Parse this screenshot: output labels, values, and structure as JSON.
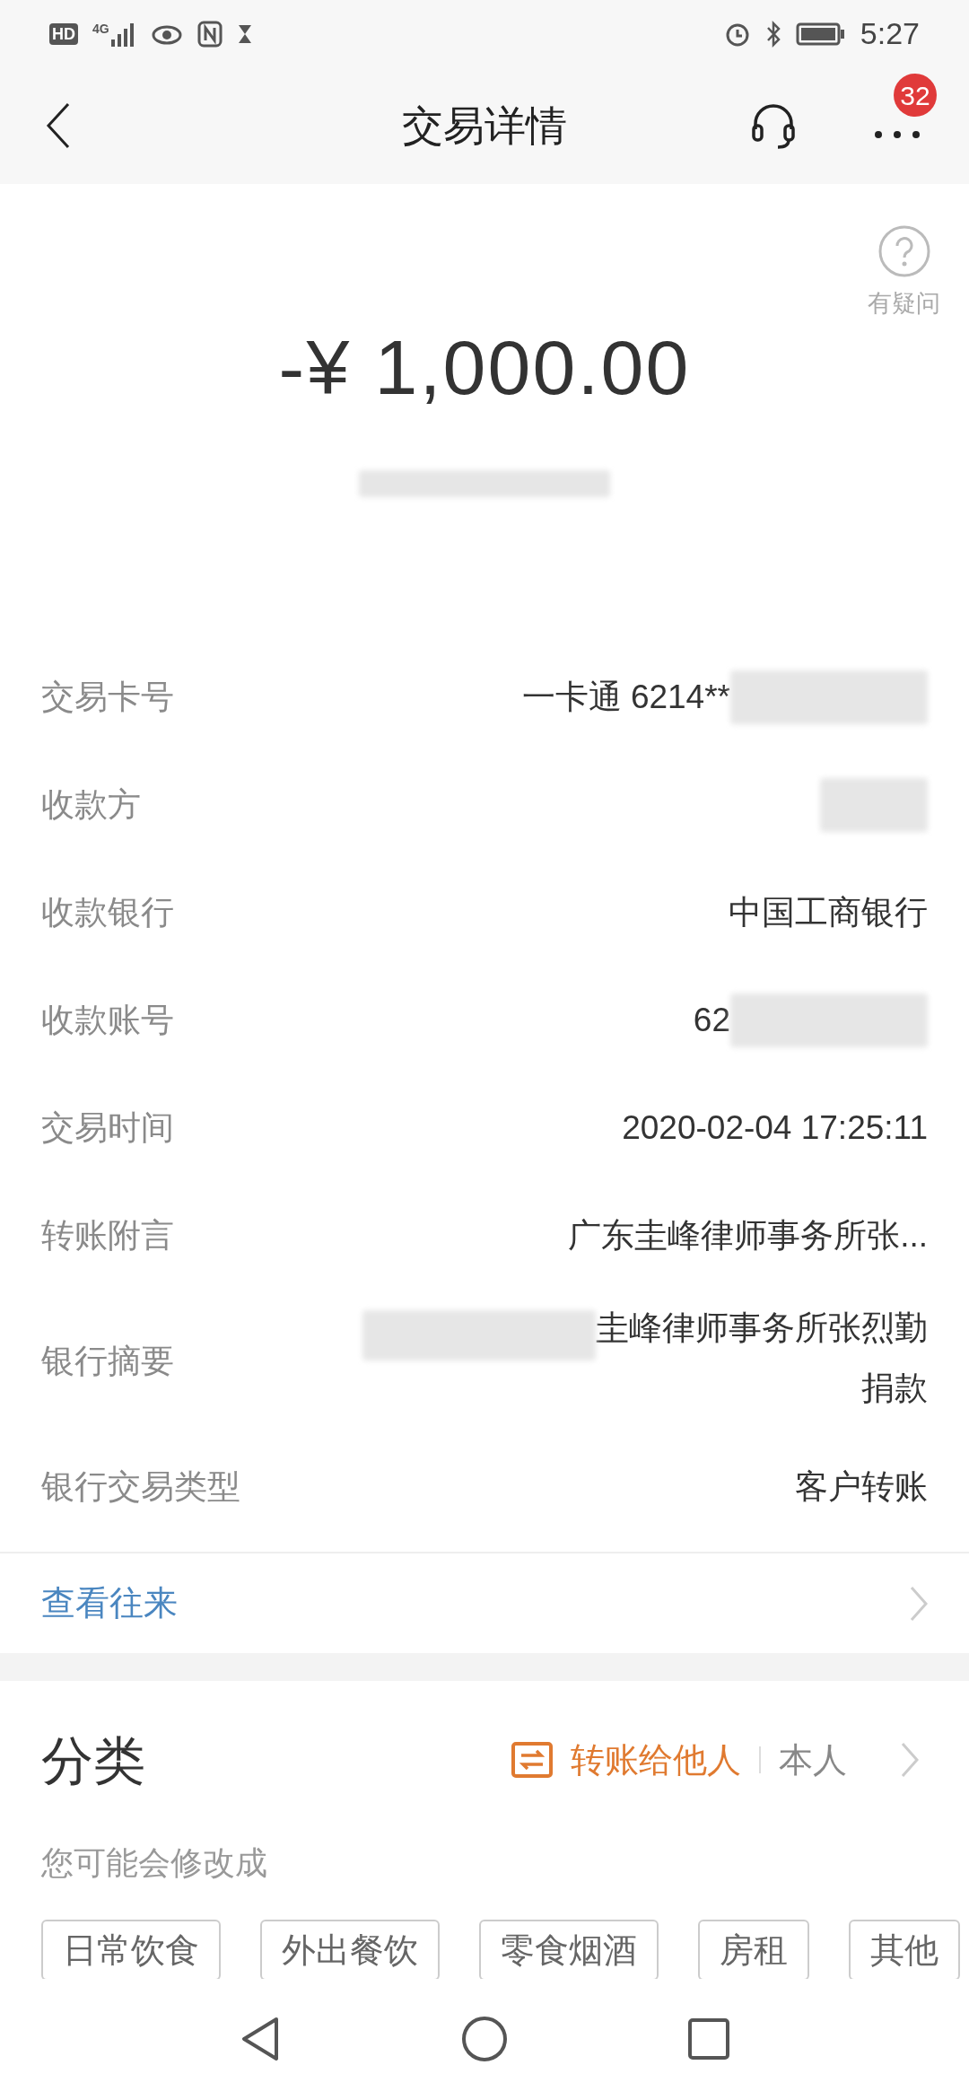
{
  "status_bar": {
    "hd": "HD",
    "network": "4G",
    "time": "5:27"
  },
  "header": {
    "title": "交易详情",
    "badge": "32"
  },
  "help": {
    "label": "有疑问"
  },
  "amount": "-¥ 1,000.00",
  "details": [
    {
      "label": "交易卡号",
      "value": "一卡通 6214**",
      "kind": "redacted_tail"
    },
    {
      "label": "收款方",
      "kind": "redacted_only"
    },
    {
      "label": "收款银行",
      "value": "中国工商银行"
    },
    {
      "label": "收款账号",
      "value": "62",
      "kind": "redacted_tail"
    },
    {
      "label": "交易时间",
      "value": "2020-02-04 17:25:11"
    },
    {
      "label": "转账附言",
      "value": "广东圭峰律师事务所张..."
    },
    {
      "label": "银行摘要",
      "value": "圭峰律师事务所张烈勤捐款",
      "kind": "redacted_lead"
    },
    {
      "label": "银行交易类型",
      "value": "客户转账"
    }
  ],
  "history_link": "查看往来",
  "category": {
    "title": "分类",
    "options": [
      {
        "label": "转账给他人",
        "selected": true
      },
      {
        "label": "本人",
        "selected": false
      }
    ],
    "hint": "您可能会修改成",
    "chips": [
      "日常饮食",
      "外出餐饮",
      "零食烟酒",
      "房租",
      "其他"
    ]
  }
}
